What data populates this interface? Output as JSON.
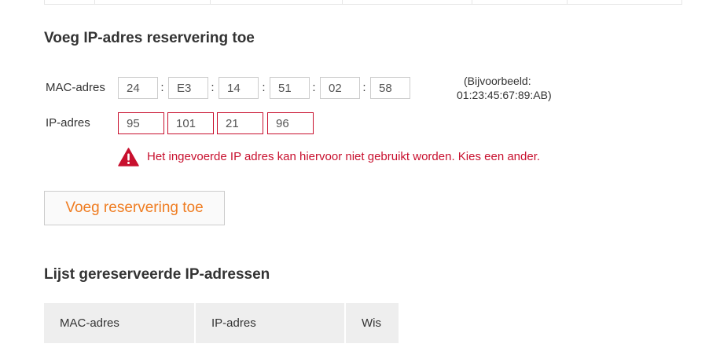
{
  "add_section": {
    "title": "Voeg IP-adres reservering toe",
    "mac_label": "MAC-adres",
    "mac_octets": [
      "24",
      "E3",
      "14",
      "51",
      "02",
      "58"
    ],
    "mac_separator": ":",
    "ip_label": "IP-adres",
    "ip_octets": [
      "95",
      "101",
      "21",
      "96"
    ],
    "example_line1": "(Bijvoorbeeld:",
    "example_line2": "01:23:45:67:89:AB)",
    "error_icon": "warning-triangle-icon",
    "error_message": "Het ingevoerde IP adres kan hiervoor niet gebruikt worden. Kies een ander.",
    "add_button_label": "Voeg reservering toe"
  },
  "list_section": {
    "title": "Lijst gereserveerde IP-adressen",
    "columns": [
      "MAC-adres",
      "IP-adres",
      "Wis"
    ]
  },
  "colors": {
    "error": "#c8102e",
    "accent": "#ef7d22",
    "table_header_bg": "#eeeeee",
    "input_border": "#cccccc"
  }
}
